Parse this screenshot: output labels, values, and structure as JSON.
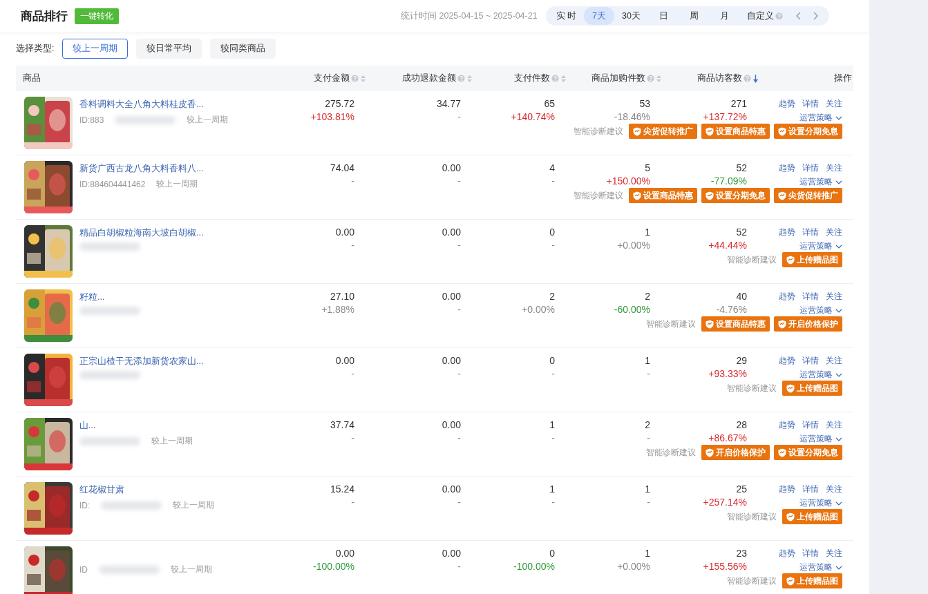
{
  "header": {
    "title": "商品排行",
    "convert_button": "一键转化",
    "stat_time": "统计时间 2025-04-15 ~ 2025-04-21",
    "ranges": [
      {
        "label": "实 时",
        "selected": false,
        "help": false
      },
      {
        "label": "7天",
        "selected": true,
        "help": false
      },
      {
        "label": "30天",
        "selected": false,
        "help": false
      },
      {
        "label": "日",
        "selected": false,
        "help": false
      },
      {
        "label": "周",
        "selected": false,
        "help": false
      },
      {
        "label": "月",
        "selected": false,
        "help": false
      },
      {
        "label": "自定义",
        "selected": false,
        "help": true
      }
    ]
  },
  "compare": {
    "label": "选择类型:",
    "options": [
      {
        "label": "较上一周期",
        "selected": true
      },
      {
        "label": "较日常平均",
        "selected": false
      },
      {
        "label": "较同类商品",
        "selected": false
      }
    ]
  },
  "table": {
    "columns": [
      {
        "label": "商品",
        "help": false,
        "sortable": false,
        "sorted": false,
        "kind": "product"
      },
      {
        "label": "支付金额",
        "help": true,
        "sortable": true,
        "sorted": false,
        "kind": "metric"
      },
      {
        "label": "成功退款金额",
        "help": true,
        "sortable": true,
        "sorted": false,
        "kind": "metric"
      },
      {
        "label": "支付件数",
        "help": true,
        "sortable": true,
        "sorted": false,
        "kind": "metric"
      },
      {
        "label": "商品加购件数",
        "help": true,
        "sortable": true,
        "sorted": false,
        "kind": "metric"
      },
      {
        "label": "商品访客数",
        "help": true,
        "sortable": false,
        "sorted": true,
        "kind": "metric"
      },
      {
        "label": "操作",
        "help": false,
        "sortable": false,
        "sorted": false,
        "kind": "action"
      }
    ],
    "rows": [
      {
        "name": "香料调料大全八角大料桂皮香...",
        "id": "ID:883",
        "blurred": true,
        "period": "较上一周期",
        "metrics": [
          {
            "value": "275.72",
            "change": "+103.81%",
            "color": "#d9292b"
          },
          {
            "value": "34.77",
            "change": "-",
            "color": "#888888"
          },
          {
            "value": "65",
            "change": "+140.74%",
            "color": "#d9292b"
          },
          {
            "value": "53",
            "change": "-18.46%",
            "color": "#888888"
          },
          {
            "value": "271",
            "change": "+137.72%",
            "color": "#d9292b"
          }
        ],
        "actions": [
          "趋势",
          "详情",
          "关注"
        ],
        "strategy": "运营策略",
        "diagnosis": "智能诊断建议",
        "suggestions": [
          "尖货促转推广",
          "设置商品特惠",
          "设置分期免息"
        ]
      },
      {
        "name": "新货广西古龙八角大料香料八...",
        "id": "ID:884604441462",
        "blurred": false,
        "period": "较上一周期",
        "metrics": [
          {
            "value": "74.04",
            "change": "-",
            "color": "#888888"
          },
          {
            "value": "0.00",
            "change": "-",
            "color": "#888888"
          },
          {
            "value": "4",
            "change": "-",
            "color": "#888888"
          },
          {
            "value": "5",
            "change": "+150.00%",
            "color": "#d9292b"
          },
          {
            "value": "52",
            "change": "-77.09%",
            "color": "#2f9a3a"
          }
        ],
        "actions": [
          "趋势",
          "详情",
          "关注"
        ],
        "strategy": "运营策略",
        "diagnosis": "智能诊断建议",
        "suggestions": [
          "设置商品特惠",
          "设置分期免息",
          "尖货促转推广"
        ]
      },
      {
        "name": "精品白胡椒粒海南大坡白胡椒...",
        "blurred": true,
        "metrics": [
          {
            "value": "0.00",
            "change": "-",
            "color": "#888888"
          },
          {
            "value": "0.00",
            "change": "-",
            "color": "#888888"
          },
          {
            "value": "0",
            "change": "-",
            "color": "#888888"
          },
          {
            "value": "1",
            "change": "+0.00%",
            "color": "#888888"
          },
          {
            "value": "52",
            "change": "+44.44%",
            "color": "#d9292b"
          }
        ],
        "actions": [
          "趋势",
          "详情",
          "关注"
        ],
        "strategy": "运营策略",
        "diagnosis": "智能诊断建议",
        "suggestions": [
          "上传赠品图"
        ]
      },
      {
        "name": "籽粒...",
        "blurred": true,
        "metrics": [
          {
            "value": "27.10",
            "change": "+1.88%",
            "color": "#888888"
          },
          {
            "value": "0.00",
            "change": "-",
            "color": "#888888"
          },
          {
            "value": "2",
            "change": "+0.00%",
            "color": "#888888"
          },
          {
            "value": "2",
            "change": "-60.00%",
            "color": "#2f9a3a"
          },
          {
            "value": "40",
            "change": "-4.76%",
            "color": "#888888"
          }
        ],
        "actions": [
          "趋势",
          "详情",
          "关注"
        ],
        "strategy": "运营策略",
        "diagnosis": "智能诊断建议",
        "suggestions": [
          "设置商品特惠",
          "开启价格保护"
        ]
      },
      {
        "name": "正宗山楂干无添加新货农家山...",
        "blurred": true,
        "metrics": [
          {
            "value": "0.00",
            "change": "-",
            "color": "#888888"
          },
          {
            "value": "0.00",
            "change": "-",
            "color": "#888888"
          },
          {
            "value": "0",
            "change": "-",
            "color": "#888888"
          },
          {
            "value": "1",
            "change": "-",
            "color": "#888888"
          },
          {
            "value": "29",
            "change": "+93.33%",
            "color": "#d9292b"
          }
        ],
        "actions": [
          "趋势",
          "详情",
          "关注"
        ],
        "strategy": "运营策略",
        "diagnosis": "智能诊断建议",
        "suggestions": [
          "上传赠品图"
        ]
      },
      {
        "name": "山...",
        "blurred": true,
        "period": "较上一周期",
        "metrics": [
          {
            "value": "37.74",
            "change": "-",
            "color": "#888888"
          },
          {
            "value": "0.00",
            "change": "-",
            "color": "#888888"
          },
          {
            "value": "1",
            "change": "-",
            "color": "#888888"
          },
          {
            "value": "2",
            "change": "-",
            "color": "#888888"
          },
          {
            "value": "28",
            "change": "+86.67%",
            "color": "#d9292b"
          }
        ],
        "actions": [
          "趋势",
          "详情",
          "关注"
        ],
        "strategy": "运营策略",
        "diagnosis": "智能诊断建议",
        "suggestions": [
          "开启价格保护",
          "设置分期免息"
        ]
      },
      {
        "name": "红花椒甘肃",
        "id": "ID:",
        "blurred": true,
        "period": "较上一周期",
        "metrics": [
          {
            "value": "15.24",
            "change": "-",
            "color": "#888888"
          },
          {
            "value": "0.00",
            "change": "-",
            "color": "#888888"
          },
          {
            "value": "1",
            "change": "-",
            "color": "#888888"
          },
          {
            "value": "1",
            "change": "-",
            "color": "#888888"
          },
          {
            "value": "25",
            "change": "+257.14%",
            "color": "#d9292b"
          }
        ],
        "actions": [
          "趋势",
          "详情",
          "关注"
        ],
        "strategy": "运营策略",
        "diagnosis": "智能诊断建议",
        "suggestions": [
          "上传赠品图"
        ]
      },
      {
        "id": "ID",
        "blurred": true,
        "period": "较上一周期",
        "metrics": [
          {
            "value": "0.00",
            "change": "-100.00%",
            "color": "#2f9a3a"
          },
          {
            "value": "0.00",
            "change": "-",
            "color": "#888888"
          },
          {
            "value": "0",
            "change": "-100.00%",
            "color": "#2f9a3a"
          },
          {
            "value": "1",
            "change": "+0.00%",
            "color": "#888888"
          },
          {
            "value": "23",
            "change": "+155.56%",
            "color": "#d9292b"
          }
        ],
        "actions": [
          "趋势",
          "详情",
          "关注"
        ],
        "strategy": "运营策略",
        "diagnosis": "智能诊断建议",
        "suggestions": [
          "上传赠品图"
        ]
      }
    ]
  }
}
